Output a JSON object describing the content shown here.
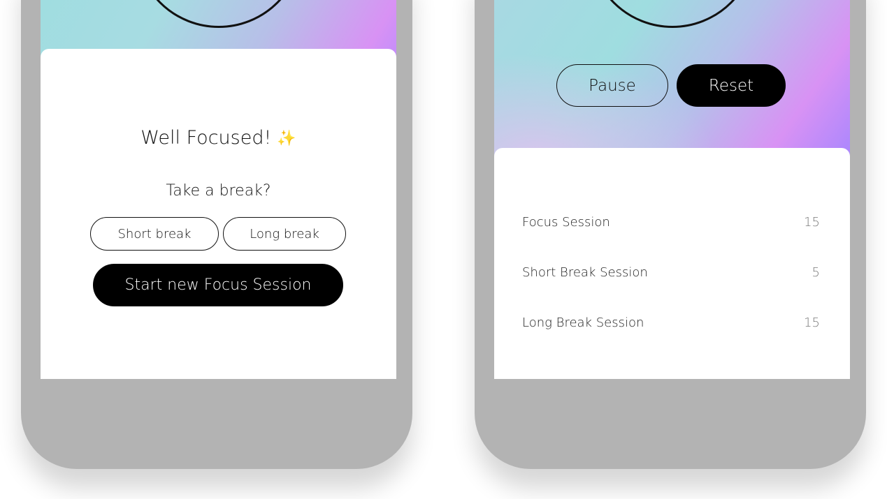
{
  "left_screen": {
    "title": "Well Focused!",
    "title_emoji": "✨",
    "subtitle": "Take a break?",
    "short_break_label": "Short break",
    "long_break_label": "Long break",
    "start_focus_label": "Start new Focus Session"
  },
  "right_screen": {
    "pause_label": "Pause",
    "reset_label": "Reset",
    "sessions": [
      {
        "name": "Focus Session",
        "value": "15"
      },
      {
        "name": "Short Break Session",
        "value": "5"
      },
      {
        "name": "Long Break Session",
        "value": "15"
      }
    ]
  },
  "colors": {
    "gradient_teal": "#9fdde0",
    "gradient_pink": "#d892f4",
    "gradient_violet": "#a184ff",
    "device_frame": "#b3b3b3",
    "primary_button": "#000000"
  }
}
